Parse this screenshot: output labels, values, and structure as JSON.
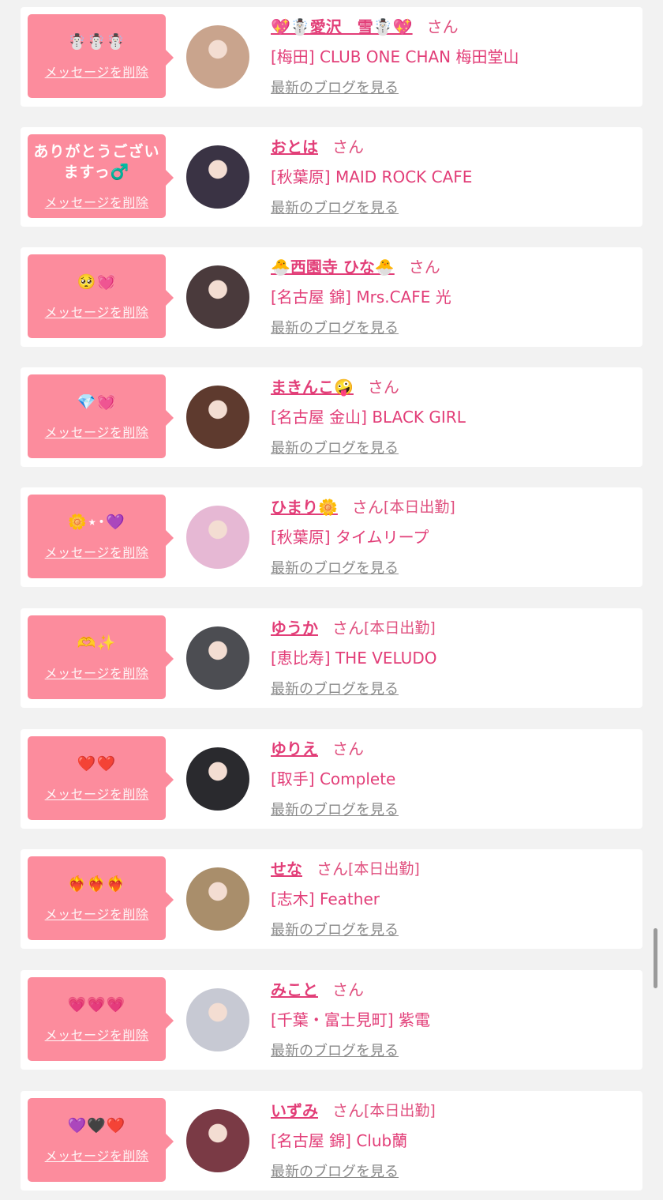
{
  "colors": {
    "accent": "#e23e78",
    "bubble": "#fc8c9d",
    "link_gray": "#8a8a8a",
    "background": "#f2f2f2"
  },
  "delete_label": "メッセージを削除",
  "blog_label": "最新のブログを見る",
  "san_label": "さん",
  "today_label": "[本日出勤]",
  "items": [
    {
      "message": "☃️☃️☃️",
      "name": "💖☃️愛沢＿雪☃️💖",
      "today": "",
      "shop": "[梅田] CLUB ONE CHAN 梅田堂山",
      "avatar_color": "#c9a48d"
    },
    {
      "message": "ありがとうございますっ♂️",
      "name": "おとは",
      "today": "",
      "shop": "[秋葉原] MAID ROCK CAFE",
      "avatar_color": "#3a3344"
    },
    {
      "message": "🥺💓",
      "name": "🐣西園寺 ひな🐣",
      "today": "",
      "shop": "[名古屋 錦] Mrs.CAFE 光",
      "avatar_color": "#4a3a3c"
    },
    {
      "message": "💎💓",
      "name": "まきんこ🤪",
      "today": "",
      "shop": "[名古屋 金山] BLACK GIRL",
      "avatar_color": "#5e3a2e"
    },
    {
      "message": "🌼⋆･💜",
      "name": "ひまり🌼",
      "today": "[本日出勤]",
      "shop": "[秋葉原] タイムリープ",
      "avatar_color": "#e6b8d4"
    },
    {
      "message": "🫶✨",
      "name": "ゆうか",
      "today": "[本日出勤]",
      "shop": "[恵比寿] THE VELUDO",
      "avatar_color": "#4c4d52"
    },
    {
      "message": "❤️❤️",
      "name": "ゆりえ",
      "today": "",
      "shop": "[取手] Complete",
      "avatar_color": "#2a2a2e"
    },
    {
      "message": "❤️‍🔥❤️‍🔥❤️‍🔥",
      "name": "せな",
      "today": "[本日出勤]",
      "shop": "[志木] Feather",
      "avatar_color": "#a98e6b"
    },
    {
      "message": "💗💗💗",
      "name": "みこと",
      "today": "",
      "shop": "[千葉・富士見町] 紫電",
      "avatar_color": "#c7c9d3"
    },
    {
      "message": "💜🖤❤️",
      "name": "いずみ",
      "today": "[本日出勤]",
      "shop": "[名古屋 錦] Club蘭",
      "avatar_color": "#7a3a45"
    }
  ]
}
